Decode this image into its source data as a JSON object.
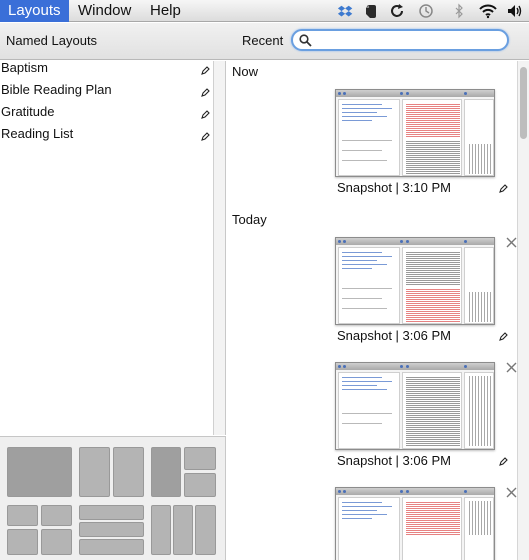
{
  "menubar": {
    "items": [
      "Layouts",
      "Window",
      "Help"
    ],
    "active_index": 0,
    "accent_color": "#3a6fd8",
    "status_icons": [
      "dropbox-icon",
      "evernote-icon",
      "sync-icon",
      "time-machine-icon",
      "bluetooth-icon",
      "wifi-icon",
      "volume-icon"
    ]
  },
  "header": {
    "named_title": "Named Layouts",
    "recent_title": "Recent",
    "search": {
      "placeholder": "",
      "value": ""
    }
  },
  "named_layouts": [
    {
      "label": "Baptism"
    },
    {
      "label": "Bible Reading Plan"
    },
    {
      "label": "Gratitude"
    },
    {
      "label": "Reading List"
    }
  ],
  "layout_templates": [
    "single-pane",
    "two-column",
    "main-with-two-right",
    "four-grid",
    "three-row",
    "three-column"
  ],
  "recent": {
    "sections": [
      {
        "label": "Now",
        "snapshots": [
          {
            "label": "Snapshot | 3:10 PM",
            "closable": false
          }
        ]
      },
      {
        "label": "Today",
        "snapshots": [
          {
            "label": "Snapshot | 3:06 PM",
            "closable": true
          },
          {
            "label": "Snapshot | 3:06 PM",
            "closable": true
          },
          {
            "label": "",
            "closable": true
          }
        ]
      }
    ]
  }
}
